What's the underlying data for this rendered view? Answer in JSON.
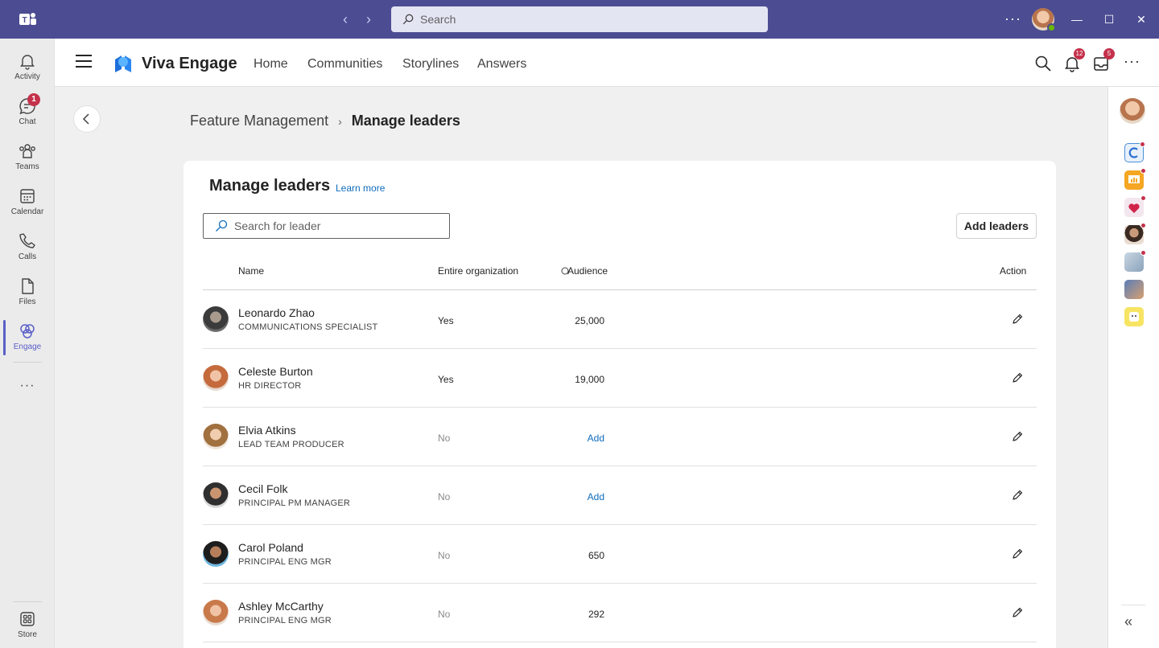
{
  "titlebar": {
    "search_placeholder": "Search",
    "more": "···",
    "win_min": "—",
    "win_max": "☐",
    "win_close": "✕",
    "nav_back": "‹",
    "nav_forward": "›"
  },
  "rail": {
    "items": [
      {
        "label": "Activity",
        "icon": "bell-icon"
      },
      {
        "label": "Chat",
        "icon": "chat-icon",
        "badge": "1"
      },
      {
        "label": "Teams",
        "icon": "teams-icon"
      },
      {
        "label": "Calendar",
        "icon": "calendar-icon"
      },
      {
        "label": "Calls",
        "icon": "phone-icon"
      },
      {
        "label": "Files",
        "icon": "file-icon"
      },
      {
        "label": "Engage",
        "icon": "engage-icon"
      }
    ],
    "more": "···",
    "store": "Store"
  },
  "header": {
    "app_title": "Viva Engage",
    "nav": [
      "Home",
      "Communities",
      "Storylines",
      "Answers"
    ],
    "notifications_badge": "12",
    "inbox_badge": "5",
    "more": "···"
  },
  "breadcrumb": {
    "parent": "Feature Management",
    "separator": "›",
    "current": "Manage leaders"
  },
  "card": {
    "title": "Manage leaders",
    "learn_more": "Learn more",
    "search_placeholder": "Search for leader",
    "add_button": "Add leaders",
    "columns": {
      "name": "Name",
      "org": "Entire organization",
      "audience": "Audience",
      "action": "Action"
    },
    "rows": [
      {
        "name": "Leonardo Zhao",
        "role": "COMMUNICATIONS SPECIALIST",
        "org": "Yes",
        "audience": "25,000"
      },
      {
        "name": "Celeste Burton",
        "role": "HR DIRECTOR",
        "org": "Yes",
        "audience": "19,000"
      },
      {
        "name": "Elvia Atkins",
        "role": "LEAD TEAM PRODUCER",
        "org": "No",
        "audience": "Add"
      },
      {
        "name": "Cecil Folk",
        "role": "PRINCIPAL PM MANAGER",
        "org": "No",
        "audience": "Add"
      },
      {
        "name": "Carol Poland",
        "role": "PRINCIPAL ENG MGR",
        "org": "No",
        "audience": "650"
      },
      {
        "name": "Ashley McCarthy",
        "role": "PRINCIPAL ENG MGR",
        "org": "No",
        "audience": "292"
      }
    ]
  },
  "colors": {
    "titlebar": "#4b4c92",
    "accent": "#5b5fc7",
    "link": "#0f6cbd",
    "badge": "#c4314b"
  }
}
